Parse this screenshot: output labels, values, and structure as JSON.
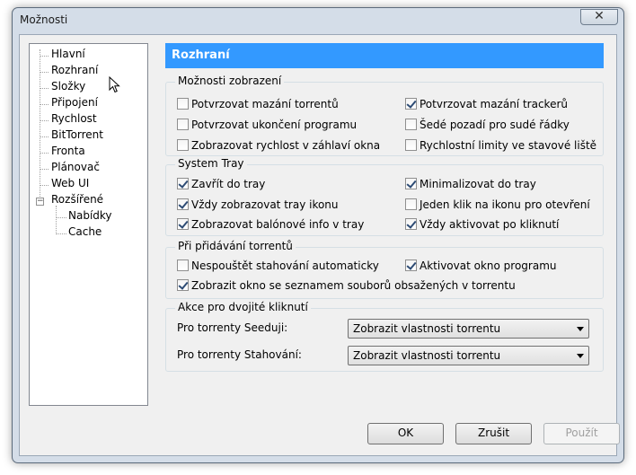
{
  "window": {
    "title": "Možnosti",
    "close_glyph": "✕"
  },
  "tree": {
    "items": [
      {
        "label": "Hlavní"
      },
      {
        "label": "Rozhraní"
      },
      {
        "label": "Složky"
      },
      {
        "label": "Připojení"
      },
      {
        "label": "Rychlost"
      },
      {
        "label": "BitTorrent"
      },
      {
        "label": "Fronta"
      },
      {
        "label": "Plánovač"
      },
      {
        "label": "Web UI"
      },
      {
        "label": "Rozšířené"
      },
      {
        "label": "Nabídky"
      },
      {
        "label": "Cache"
      }
    ],
    "expander_glyph": "−"
  },
  "panel": {
    "header": "Rozhraní",
    "display": {
      "title": "Možnosti zobrazení",
      "options": [
        {
          "label": "Potvrzovat mazání torrentů",
          "checked": false
        },
        {
          "label": "Potvrzovat mazání trackerů",
          "checked": true
        },
        {
          "label": "Potvrzovat ukončení programu",
          "checked": false
        },
        {
          "label": "Šedé pozadí pro sudé řádky",
          "checked": false
        },
        {
          "label": "Zobrazovat rychlost v záhlaví okna",
          "checked": false
        },
        {
          "label": "Rychlostní limity ve stavové liště",
          "checked": false
        }
      ]
    },
    "tray": {
      "title": "System Tray",
      "options": [
        {
          "label": "Zavřít do tray",
          "checked": true
        },
        {
          "label": "Minimalizovat do tray",
          "checked": true
        },
        {
          "label": "Vždy zobrazovat tray ikonu",
          "checked": true
        },
        {
          "label": "Jeden klik na ikonu pro otevření",
          "checked": false
        },
        {
          "label": "Zobrazovat balónové info v tray",
          "checked": true
        },
        {
          "label": "Vždy aktivovat po kliknutí",
          "checked": true
        }
      ]
    },
    "adding": {
      "title": "Při přidávání torrentů",
      "options": [
        {
          "label": "Nespouštět stahování automaticky",
          "checked": false
        },
        {
          "label": "Aktivovat okno programu",
          "checked": true
        },
        {
          "label": "Zobrazit okno se seznamem souborů obsažených v torrentu",
          "checked": true
        }
      ]
    },
    "doubleclick": {
      "title": "Akce pro dvojité kliknutí",
      "seeding_label": "Pro torrenty Seeduji:",
      "seeding_value": "Zobrazit vlastnosti torrentu",
      "downloading_label": "Pro torrenty Stahování:",
      "downloading_value": "Zobrazit vlastnosti torrentu"
    }
  },
  "buttons": {
    "ok": "OK",
    "cancel": "Zrušit",
    "apply": "Použít"
  }
}
